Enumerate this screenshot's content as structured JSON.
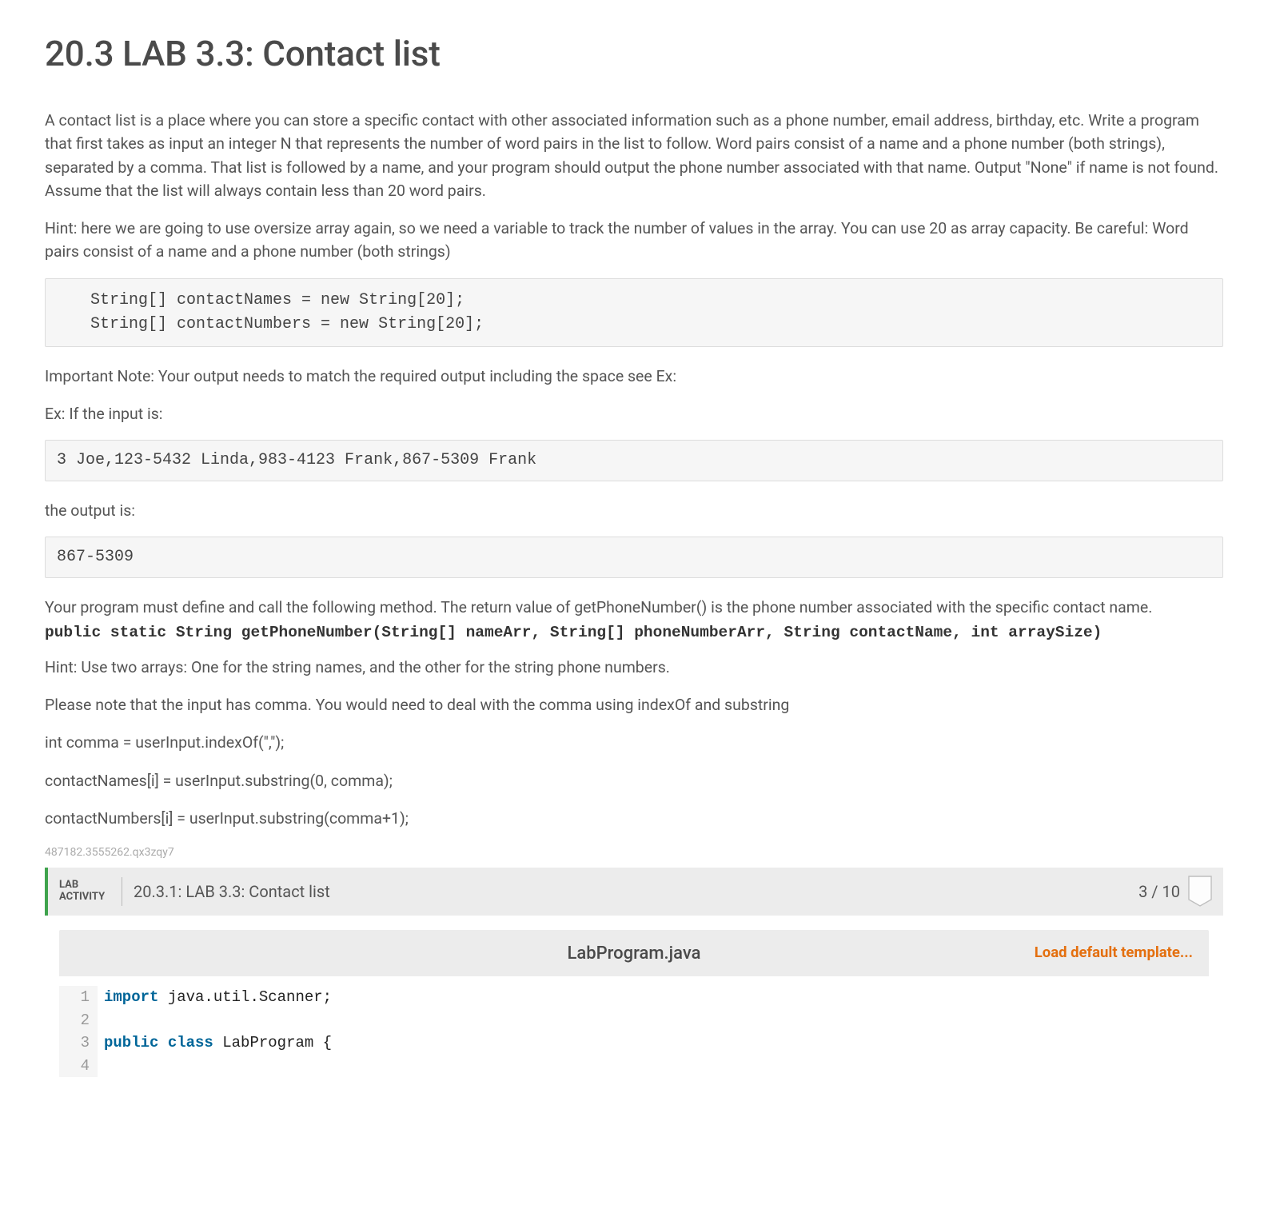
{
  "title": "20.3 LAB 3.3: Contact list",
  "intro": "A contact list is a place where you can store a specific contact with other associated information such as a phone number, email address, birthday, etc. Write a program that first takes as input an integer N that represents the number of word pairs in the list to follow. Word pairs consist of a name and a phone number (both strings), separated by a comma. That list is followed by a name, and your program should output the phone number associated with that name. Output \"None\" if name is not found. Assume that the list will always contain less than 20 word pairs.",
  "hint_bold": "Hint: here we are going to use oversize array again, so we need a variable to track the number of values in the array. You can use 20 as array capacity. Be careful: Word pairs consist of a name and a phone number (both strings)",
  "code_decl": "   String[] contactNames = new String[20];\n   String[] contactNumbers = new String[20];",
  "important_note": "Important Note: Your output needs to match the required output including the space see Ex:",
  "ex_label": "Ex: If the input is:",
  "ex_input": "3 Joe,123-5432 Linda,983-4123 Frank,867-5309 Frank",
  "output_label": "the output is:",
  "ex_output": "867-5309",
  "method_desc": "Your program must define and call the following method. The return value of getPhoneNumber() is the phone number associated with the specific contact name.",
  "method_sig": "public static String getPhoneNumber(String[] nameArr, String[] phoneNumberArr, String contactName, int arraySize)",
  "hint2": "Hint: Use two arrays: One for the string names, and the other for the string phone numbers.",
  "note_comma": "Please note that the input has comma. You would need to deal with the comma using indexOf and substring",
  "snip1": "int comma = userInput.indexOf(\",\");",
  "snip2": "contactNames[i] = userInput.substring(0, comma);",
  "snip3": "contactNumbers[i] = userInput.substring(comma+1);",
  "tiny_id": "487182.3555262.qx3zqy7",
  "lab": {
    "tag": "LAB ACTIVITY",
    "title": "20.3.1: LAB 3.3: Contact list",
    "score": "3 / 10",
    "file_name": "LabProgram.java",
    "load_link": "Load default template...",
    "lines": [
      {
        "n": "1",
        "html": "<span class=\"kw\">import</span> java.util.Scanner;"
      },
      {
        "n": "2",
        "html": ""
      },
      {
        "n": "3",
        "html": "<span class=\"kw\">public</span> <span class=\"kw2\">class</span> <span class=\"cls\">LabProgram</span> {"
      },
      {
        "n": "4",
        "html": ""
      }
    ]
  }
}
